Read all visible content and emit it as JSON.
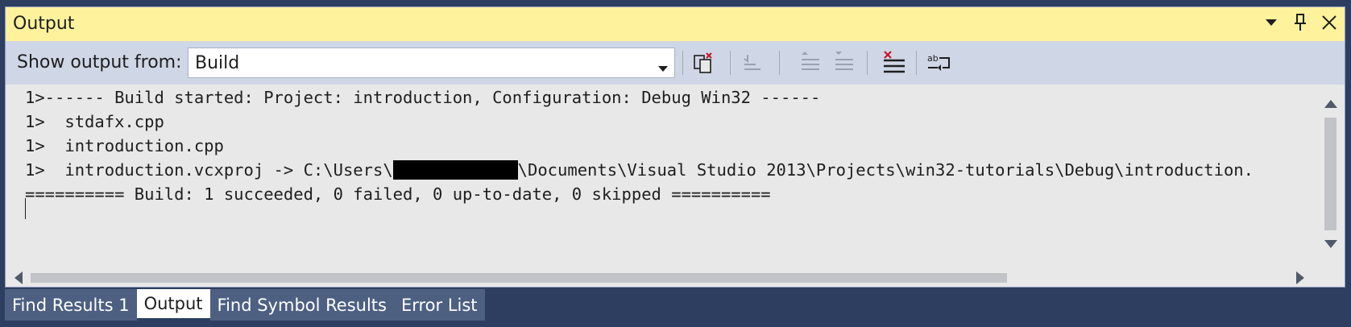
{
  "panel": {
    "title": "Output"
  },
  "toolbar": {
    "show_label": "Show output from:",
    "source_value": "Build",
    "buttons": [
      "find-message-in-code-icon",
      "go-to-previous-message-icon",
      "go-to-next-message-icon",
      "clear-all-icon",
      "toggle-word-wrap-icon"
    ]
  },
  "output": {
    "lines": [
      "1>------ Build started: Project: introduction, Configuration: Debug Win32 ------",
      "1>  stdafx.cpp",
      "1>  introduction.cpp",
      "========== Build: 1 succeeded, 0 failed, 0 up-to-date, 0 skipped =========="
    ],
    "line4_prefix": "1>  introduction.vcxproj -> C:\\Users\\",
    "line4_suffix": "\\Documents\\Visual Studio 2013\\Projects\\win32-tutorials\\Debug\\introduction."
  },
  "tabs": [
    "Find Results 1",
    "Output",
    "Find Symbol Results",
    "Error List"
  ],
  "active_tab": "Output",
  "colors": {
    "title_bar": "#fff29d",
    "toolbar": "#cfd6e5",
    "background": "#2d3e60",
    "tab_inactive": "#4d6082",
    "redaction": "#000000"
  }
}
